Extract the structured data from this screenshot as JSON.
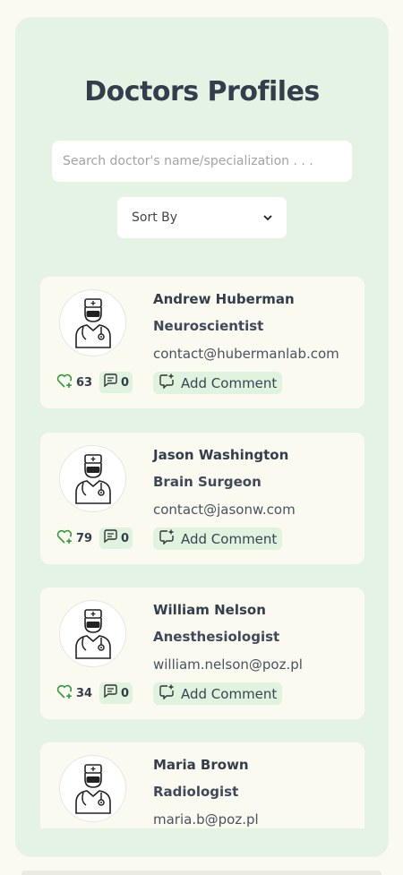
{
  "page": {
    "title": "Doctors Profiles",
    "search_placeholder": "Search doctor's name/specialization . . .",
    "sort_label": "Sort By"
  },
  "colors": {
    "panel_bg": "#e4f3e4",
    "card_bg": "#fbfaf1",
    "badge_bg": "#dff3df",
    "heart_green": "#2e9b3a",
    "text_dark": "#333d4b"
  },
  "icons": {
    "avatar": "doctor-avatar-icon",
    "likes": "heart-plus-icon",
    "comments": "comment-icon",
    "add_comment": "comment-plus-icon",
    "sort": "chevron-down-icon"
  },
  "add_comment_label": "Add Comment",
  "doctors": [
    {
      "name": "Andrew Huberman",
      "specialization": "Neuroscientist",
      "email": "contact@hubermanlab.com",
      "likes": "63",
      "comments": "0"
    },
    {
      "name": "Jason Washington",
      "specialization": "Brain Surgeon",
      "email": "contact@jasonw.com",
      "likes": "79",
      "comments": "0"
    },
    {
      "name": "William Nelson",
      "specialization": "Anesthesiologist",
      "email": "william.nelson@poz.pl",
      "likes": "34",
      "comments": "0"
    },
    {
      "name": "Maria Brown",
      "specialization": "Radiologist",
      "email": "maria.b@poz.pl",
      "likes": "",
      "comments": ""
    }
  ]
}
